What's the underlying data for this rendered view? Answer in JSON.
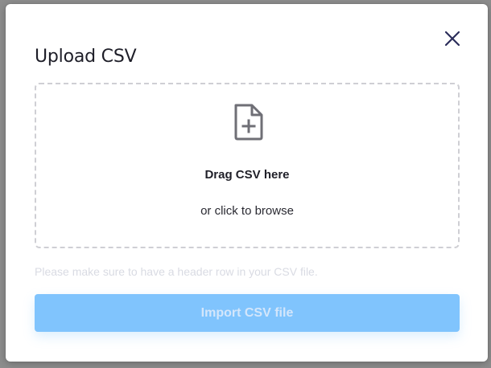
{
  "dialog": {
    "title": "Upload CSV",
    "close_icon": "close-icon"
  },
  "dropzone": {
    "icon": "file-plus-icon",
    "title": "Drag CSV here",
    "subtitle": "or click to browse"
  },
  "hint": "Please make sure to have a header row in your CSV file.",
  "import_button": {
    "label": "Import CSV file",
    "color": "#80c4fd",
    "state": "disabled"
  },
  "colors": {
    "title": "#1e1e28",
    "close_icon": "#2b2d5a",
    "dropzone_border": "#cfcfd4",
    "file_icon": "#6f6f76"
  }
}
